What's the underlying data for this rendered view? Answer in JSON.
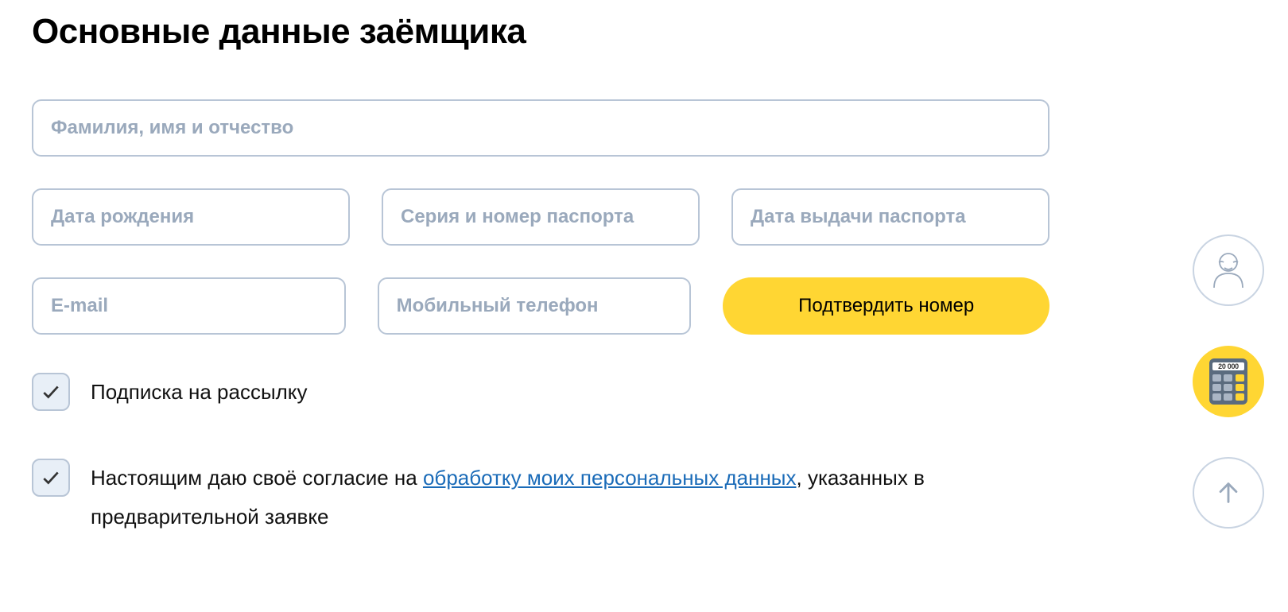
{
  "title": "Основные данные заёмщика",
  "fields": {
    "fullname_placeholder": "Фамилия, имя и отчество",
    "birthdate_placeholder": "Дата рождения",
    "passport_placeholder": "Серия и номер паспорта",
    "passport_date_placeholder": "Дата выдачи паспорта",
    "email_placeholder": "E-mail",
    "phone_placeholder": "Мобильный телефон"
  },
  "buttons": {
    "confirm_phone": "Подтвердить номер"
  },
  "checkboxes": {
    "newsletter_label": "Подписка на рассылку",
    "newsletter_checked": true,
    "consent_prefix": "Настоящим даю своё согласие на ",
    "consent_link": "обработку моих персональных данных",
    "consent_suffix": ", указанных в предварительной заявке",
    "consent_checked": true
  },
  "floating": {
    "calc_display": "20 000"
  }
}
